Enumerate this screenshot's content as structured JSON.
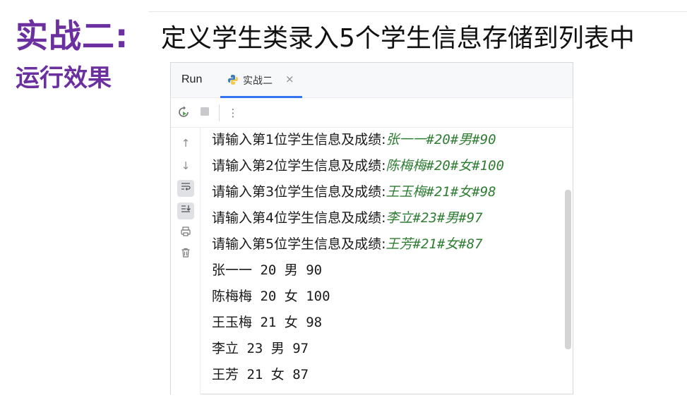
{
  "slide": {
    "title": "实战二:",
    "title_desc": "定义学生类录入5个学生信息存储到列表中",
    "subtitle": "运行效果"
  },
  "run_panel": {
    "run_label": "Run",
    "tab_label": "实战二",
    "tab_close": "×",
    "toolbar_icons": [
      "rerun-icon",
      "stop-icon",
      "more-icon"
    ],
    "gutter_icons": [
      "up-arrow-icon",
      "down-arrow-icon",
      "soft-wrap-icon",
      "scroll-to-end-icon",
      "print-icon",
      "trash-icon"
    ],
    "console_lines": [
      {
        "prompt": "请输入第1位学生信息及成绩:",
        "input": "张一一#20#男#90"
      },
      {
        "prompt": "请输入第2位学生信息及成绩:",
        "input": "陈梅梅#20#女#100"
      },
      {
        "prompt": "请输入第3位学生信息及成绩:",
        "input": "王玉梅#21#女#98"
      },
      {
        "prompt": "请输入第4位学生信息及成绩:",
        "input": "李立#23#男#97"
      },
      {
        "prompt": "请输入第5位学生信息及成绩:",
        "input": "王芳#21#女#87"
      }
    ],
    "output_lines": [
      "张一一 20 男 90",
      "陈梅梅 20 女 100",
      "王玉梅 21 女 98",
      "李立 23 男 97",
      "王芳 21 女 87"
    ]
  },
  "colors": {
    "title_purple": "#6b2fa0",
    "input_green": "#2e7d32",
    "tab_accent": "#3574f0"
  }
}
